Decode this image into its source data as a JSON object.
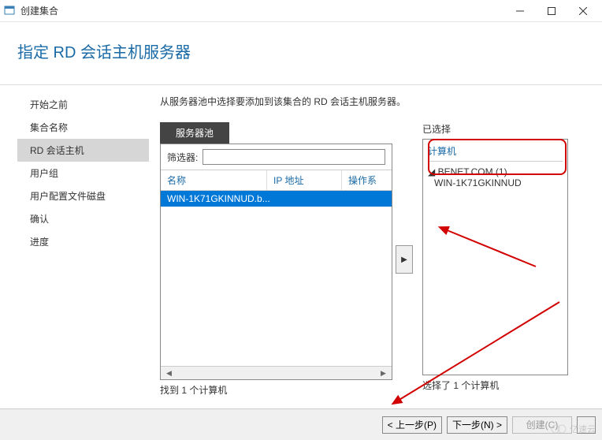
{
  "window": {
    "title": "创建集合"
  },
  "header": {
    "title": "指定 RD 会话主机服务器"
  },
  "sidebar": {
    "items": [
      {
        "label": "开始之前"
      },
      {
        "label": "集合名称"
      },
      {
        "label": "RD 会话主机"
      },
      {
        "label": "用户组"
      },
      {
        "label": "用户配置文件磁盘"
      },
      {
        "label": "确认"
      },
      {
        "label": "进度"
      }
    ],
    "active_index": 2
  },
  "main": {
    "instruction": "从服务器池中选择要添加到该集合的 RD 会话主机服务器。",
    "pool": {
      "tab_label": "服务器池",
      "filter_label": "筛选器:",
      "filter_value": "",
      "columns": {
        "name": "名称",
        "ip": "IP 地址",
        "os": "操作系"
      },
      "rows": [
        {
          "name": "WIN-1K71GKINNUD.b..."
        }
      ],
      "found_text": "找到 1 个计算机"
    },
    "move_button_icon": "▶",
    "selected": {
      "title": "已选择",
      "column_label": "计算机",
      "group": "BENET.COM (1)",
      "group_prefix": "◢",
      "items": [
        "WIN-1K71GKINNUD"
      ],
      "count_text": "选择了 1 个计算机"
    }
  },
  "footer": {
    "prev": "< 上一步(P)",
    "next": "下一步(N) >",
    "create": "创建(C)",
    "cancel_visible_partial": true
  },
  "watermark": {
    "text": "亿速云"
  }
}
